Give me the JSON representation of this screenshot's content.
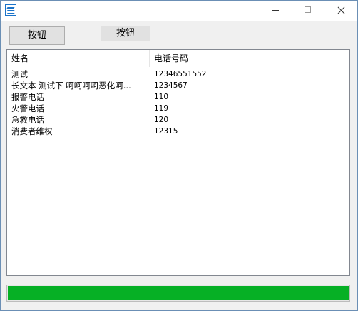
{
  "toolbar": {
    "button1_label": "按钮",
    "button2_label": "按钮"
  },
  "list": {
    "columns": [
      "姓名",
      "电话号码",
      ""
    ],
    "rows": [
      {
        "name": "测试",
        "phone": "12346551552"
      },
      {
        "name": "长文本 测试下 呵呵呵呵恶化呵...",
        "phone": "1234567"
      },
      {
        "name": "报警电话",
        "phone": "110"
      },
      {
        "name": "火警电话",
        "phone": "119"
      },
      {
        "name": "急救电话",
        "phone": "120"
      },
      {
        "name": "消费者维权",
        "phone": "12315"
      }
    ]
  },
  "progress": {
    "value_percent": 100,
    "color": "#06b025"
  }
}
